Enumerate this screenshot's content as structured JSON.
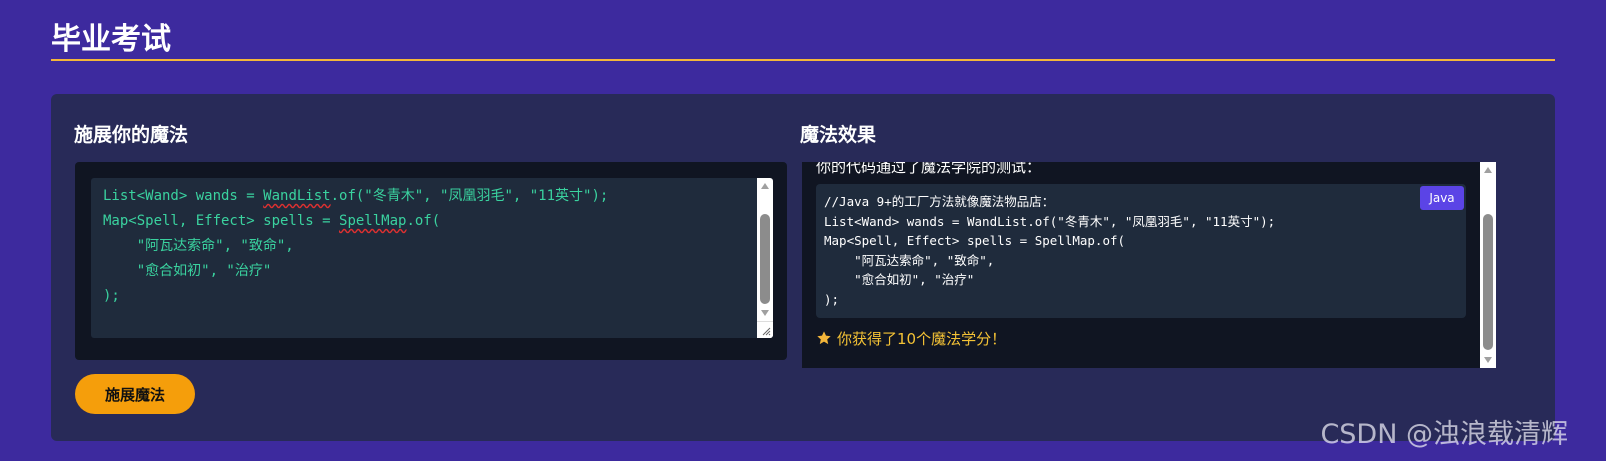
{
  "page": {
    "title": "毕业考试"
  },
  "editor_section": {
    "heading": "施展你的魔法",
    "code_lines": [
      [
        "List<Wand> wands = ",
        "WandList",
        ".of(\"冬青木\", \"凤凰羽毛\", \"11英寸\");"
      ],
      [
        "Map<Spell, Effect> spells = ",
        "SpellMap",
        ".of("
      ],
      [
        "    \"阿瓦达索命\", \"致命\","
      ],
      [
        "    \"愈合如初\", \"治疗\""
      ],
      [
        ");"
      ]
    ],
    "submit_label": "施展魔法"
  },
  "result_section": {
    "heading": "魔法效果",
    "intro_text": "你的代码通过了魔法学院的测试：",
    "code_language": "Java",
    "code_text": "//Java 9+的工厂方法就像魔法物品店：\nList<Wand> wands = WandList.of(\"冬青木\", \"凤凰羽毛\", \"11英寸\");\nMap<Spell, Effect> spells = SpellMap.of(\n    \"阿瓦达索命\", \"致命\",\n    \"愈合如初\", \"治疗\"\n);",
    "reward_text": "你获得了10个魔法学分！"
  },
  "watermark": "CSDN @浊浪载清辉",
  "colors": {
    "background": "#3d2a9e",
    "panel": "#282a58",
    "accent_rule": "#f4b63a",
    "button": "#f59e0b",
    "code_green": "#3ad29f",
    "badge": "#5b44e6",
    "reward": "#f4c235"
  },
  "icons": {
    "reward": "star-icon"
  }
}
